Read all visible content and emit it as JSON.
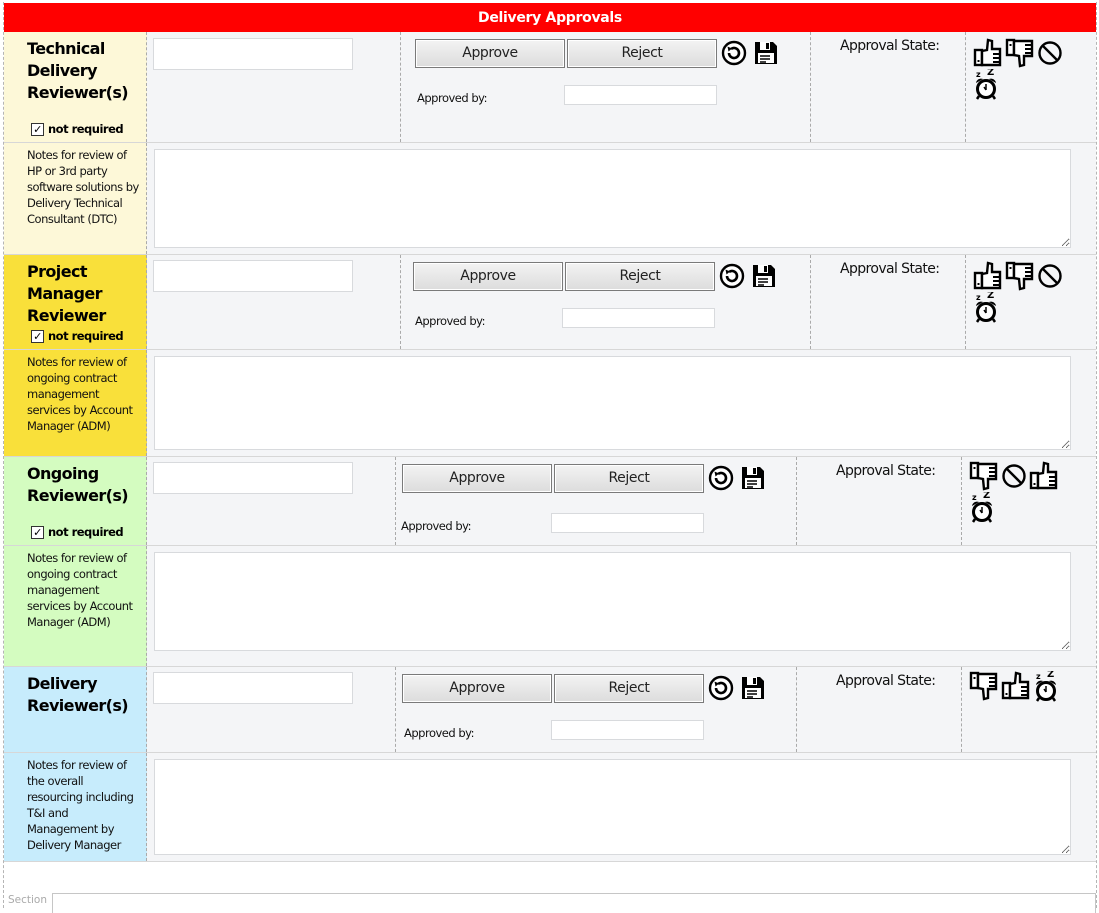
{
  "title": "Delivery Approvals",
  "colors": {
    "title_bar": "#ff0000",
    "technical": "#fdf8d8",
    "project_manager": "#f9e03a",
    "ongoing": "#d4fcc0",
    "delivery": "#c7ecfc"
  },
  "labels": {
    "approve": "Approve",
    "reject": "Reject",
    "approved_by": "Approved by:",
    "approval_state": "Approval State:",
    "not_required": "not required",
    "checkmark": "✓"
  },
  "sections": [
    {
      "id": "technical",
      "title": "Technical Delivery Reviewer(s)",
      "not_required_checked": true,
      "reviewer_value": "",
      "approved_by_value": "",
      "notes_label": "Notes for review of HP or 3rd party software solutions by Delivery Technical Consultant (DTC)",
      "notes_value": "",
      "state_icons": [
        "thumbs-up-icon",
        "thumbs-down-icon",
        "not-allowed-icon",
        "snooze-alarm-icon"
      ]
    },
    {
      "id": "project_manager",
      "title": "Project Manager Reviewer",
      "not_required_checked": true,
      "reviewer_value": "",
      "approved_by_value": "",
      "notes_label": "Notes for review of ongoing contract management services by Account Manager (ADM)",
      "notes_value": "",
      "state_icons": [
        "thumbs-up-icon",
        "thumbs-down-icon",
        "not-allowed-icon",
        "snooze-alarm-icon"
      ]
    },
    {
      "id": "ongoing",
      "title": "Ongoing Reviewer(s)",
      "not_required_checked": true,
      "reviewer_value": "",
      "approved_by_value": "",
      "notes_label": "Notes for review of ongoing contract management services by Account Manager (ADM)",
      "notes_value": "",
      "state_icons": [
        "thumbs-down-icon",
        "not-allowed-icon",
        "thumbs-up-icon",
        "snooze-alarm-icon"
      ]
    },
    {
      "id": "delivery",
      "title": "Delivery Reviewer(s)",
      "not_required_checked": null,
      "reviewer_value": "",
      "approved_by_value": "",
      "notes_label": "Notes for review of the overall resourcing including T&I and Management by Delivery Manager",
      "notes_value": "",
      "state_icons": [
        "thumbs-down-icon",
        "thumbs-up-icon",
        "snooze-alarm-icon"
      ]
    }
  ],
  "footer": {
    "section_label": "Section",
    "section_value": ""
  }
}
